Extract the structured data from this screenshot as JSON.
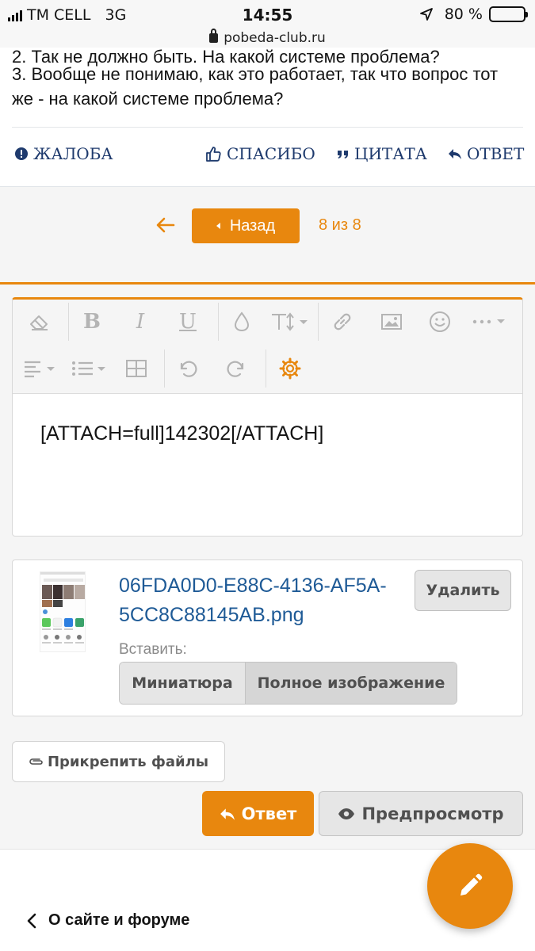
{
  "status_bar": {
    "carrier": "TM CELL",
    "network": "3G",
    "time": "14:55",
    "battery": "80 %",
    "battery_level": 0.8
  },
  "browser": {
    "url": "pobeda-club.ru"
  },
  "post": {
    "cut_line": "2. Так не должно быть. На какой системе проблема?",
    "paragraph": "3. Вообще не понимаю, как это работает, так что вопрос тот же - на какой системе проблема?",
    "actions": {
      "report": "ЖАЛОБА",
      "thanks": "СПАСИБО",
      "quote": "ЦИТАТА",
      "reply": "ОТВЕТ"
    }
  },
  "pagination": {
    "back_label": "Назад",
    "counter": "8 из 8"
  },
  "editor": {
    "content": "[ATTACH=full]142302[/ATTACH]",
    "toolbar": [
      "eraser-icon",
      "bold-icon",
      "italic-icon",
      "underline-icon",
      "drop-icon",
      "font-size-icon",
      "link-icon",
      "image-icon",
      "smile-icon",
      "more-icon",
      "align-icon",
      "list-icon",
      "table-icon",
      "undo-icon",
      "redo-icon",
      "gear-icon"
    ]
  },
  "attachment": {
    "file_name": "06FDA0D0-E88C-4136-AF5A-5CC8C88145AB.png",
    "delete_label": "Удалить",
    "insert_label": "Вставить:",
    "insert_thumbnail": "Миниатюра",
    "insert_full": "Полное изображение"
  },
  "buttons": {
    "attach_files": "Прикрепить файлы",
    "reply": "Ответ",
    "preview": "Предпросмотр"
  },
  "footer": {
    "link": "О сайте и форуме"
  },
  "colors": {
    "accent": "#e8870e",
    "action_text": "#1e3a6d",
    "file_link": "#1e5a96"
  }
}
